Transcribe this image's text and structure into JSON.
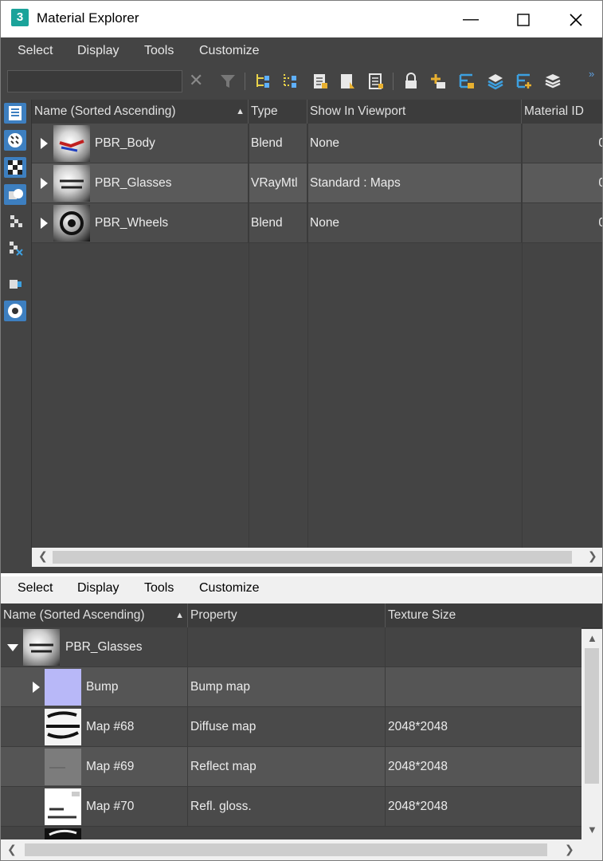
{
  "window": {
    "title": "Material Explorer",
    "app_icon_label": "3"
  },
  "upper_menu": [
    "Select",
    "Display",
    "Tools",
    "Customize"
  ],
  "search": {
    "value": "",
    "placeholder": ""
  },
  "upper_table": {
    "headers": [
      "Name (Sorted Ascending)",
      "Type",
      "Show In Viewport",
      "Material ID"
    ],
    "rows": [
      {
        "name": "PBR_Body",
        "type": "Blend",
        "viewport": "None",
        "material_id": "0"
      },
      {
        "name": "PBR_Glasses",
        "type": "VRayMtl",
        "viewport": "Standard : Maps",
        "material_id": "0"
      },
      {
        "name": "PBR_Wheels",
        "type": "Blend",
        "viewport": "None",
        "material_id": "0"
      }
    ]
  },
  "lower_menu": [
    "Select",
    "Display",
    "Tools",
    "Customize"
  ],
  "lower_table": {
    "headers": [
      "Name (Sorted Ascending)",
      "Property",
      "Texture Size"
    ],
    "parent": "PBR_Glasses",
    "rows": [
      {
        "name": "Bump",
        "property": "Bump map",
        "texture_size": ""
      },
      {
        "name": "Map #68",
        "property": "Diffuse map",
        "texture_size": "2048*2048"
      },
      {
        "name": "Map #69",
        "property": "Reflect map",
        "texture_size": "2048*2048"
      },
      {
        "name": "Map #70",
        "property": "Refl. gloss.",
        "texture_size": "2048*2048"
      }
    ]
  },
  "colors": {
    "panel": "#444444",
    "accent": "#3d7fc0",
    "row_selected": "#5a5a5a"
  }
}
